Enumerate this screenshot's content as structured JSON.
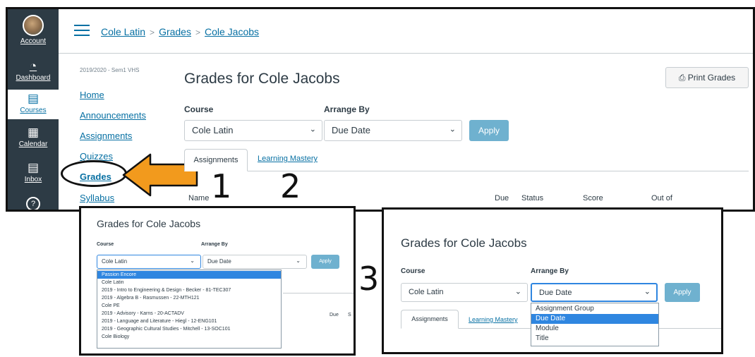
{
  "nav": {
    "account": "Account",
    "dashboard": "Dashboard",
    "courses": "Courses",
    "calendar": "Calendar",
    "inbox": "Inbox"
  },
  "breadcrumb": [
    "Cole Latin",
    "Grades",
    "Cole Jacobs"
  ],
  "course_nav": {
    "term": "2019/2020 - Sem1 VHS",
    "links": [
      "Home",
      "Announcements",
      "Assignments",
      "Quizzes",
      "Grades",
      "Syllabus"
    ]
  },
  "page": {
    "title": "Grades for Cole Jacobs",
    "print_label": "Print Grades",
    "course_label": "Course",
    "arrange_label": "Arrange By",
    "course_value": "Cole Latin",
    "arrange_value": "Due Date",
    "apply_label": "Apply",
    "tabs": [
      "Assignments",
      "Learning Mastery"
    ],
    "columns": [
      "Name",
      "Due",
      "Status",
      "Score",
      "Out of"
    ]
  },
  "annotations": [
    "1",
    "2",
    "3"
  ],
  "panel_course": {
    "title": "Grades for Cole Jacobs",
    "course_label": "Course",
    "arrange_label": "Arrange By",
    "course_value": "Cole Latin",
    "arrange_value": "Due Date",
    "apply_label": "Apply",
    "columns": [
      "Due",
      "S"
    ],
    "options": [
      "Passion Encore",
      "Cole Latin",
      "2019 - Intro to Engineering & Design - Becker - 81-TEC307",
      "2019 - Algebra B - Rasmussen - 22-MTH121",
      "Cole PE",
      "2019 - Advisory - Karns - 20-ACTADV",
      "2019 - Language and Literature - Hiegl - 12-ENG101",
      "2019 - Geographic Cultural Studies - Mitchell - 13-SOC101",
      "Cole Biology"
    ],
    "selected_index": 0
  },
  "panel_arrange": {
    "title": "Grades for Cole Jacobs",
    "course_label": "Course",
    "arrange_label": "Arrange By",
    "course_value": "Cole Latin",
    "arrange_value": "Due Date",
    "apply_label": "Apply",
    "tabs": [
      "Assignments",
      "Learning Mastery"
    ],
    "options": [
      "Assignment Group",
      "Due Date",
      "Module",
      "Title"
    ],
    "selected_index": 1
  },
  "colors": {
    "nav_bg": "#2d3b45",
    "link": "#0770a3",
    "apply": "#6fb1cf",
    "arrow": "#f29a1d",
    "selection": "#2f86e0"
  }
}
